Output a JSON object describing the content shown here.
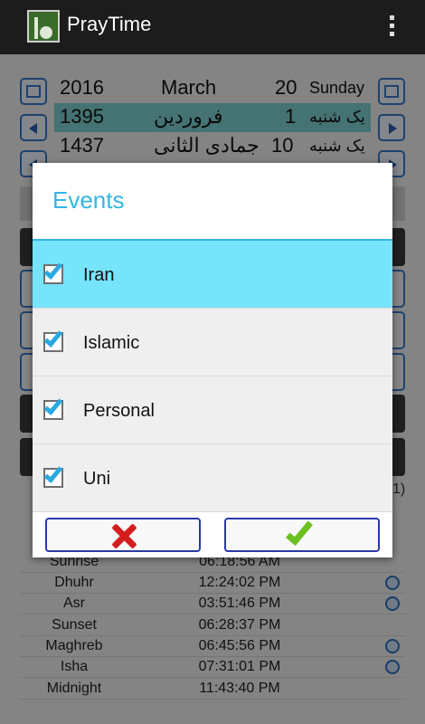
{
  "app": {
    "title": "PrayTime"
  },
  "dates": {
    "gregorian": {
      "year": "2016",
      "month": "March",
      "day": "20",
      "weekday": "Sunday"
    },
    "persian": {
      "year": "1395",
      "month": "فروردین",
      "day": "1",
      "weekday": "یک شنبه"
    },
    "hijri": {
      "year": "1437",
      "month": "جمادی الثانی",
      "day": "10",
      "weekday": "یک شنبه"
    }
  },
  "partial_text": "1)",
  "prayers": [
    {
      "name": "Sunrise",
      "time": "06:18:56 AM",
      "alarm": false
    },
    {
      "name": "Dhuhr",
      "time": "12:24:02 PM",
      "alarm": true
    },
    {
      "name": "Asr",
      "time": "03:51:46 PM",
      "alarm": true
    },
    {
      "name": "Sunset",
      "time": "06:28:37 PM",
      "alarm": false
    },
    {
      "name": "Maghreb",
      "time": "06:45:56 PM",
      "alarm": true
    },
    {
      "name": "Isha",
      "time": "07:31:01 PM",
      "alarm": true
    },
    {
      "name": "Midnight",
      "time": "11:43:40 PM",
      "alarm": false
    }
  ],
  "dialog": {
    "title": "Events",
    "items": [
      {
        "label": "Iran",
        "checked": true,
        "highlighted": true
      },
      {
        "label": "Islamic",
        "checked": true,
        "highlighted": false
      },
      {
        "label": "Personal",
        "checked": true,
        "highlighted": false
      },
      {
        "label": "Uni",
        "checked": true,
        "highlighted": false
      }
    ],
    "cancel_icon": "close-icon",
    "ok_icon": "check-icon"
  },
  "colors": {
    "accent": "#33b5e5",
    "highlight": "#76e4fb",
    "selected_date_row": "#7fcfd0",
    "cancel": "#d41e1e",
    "ok": "#6cc021"
  }
}
